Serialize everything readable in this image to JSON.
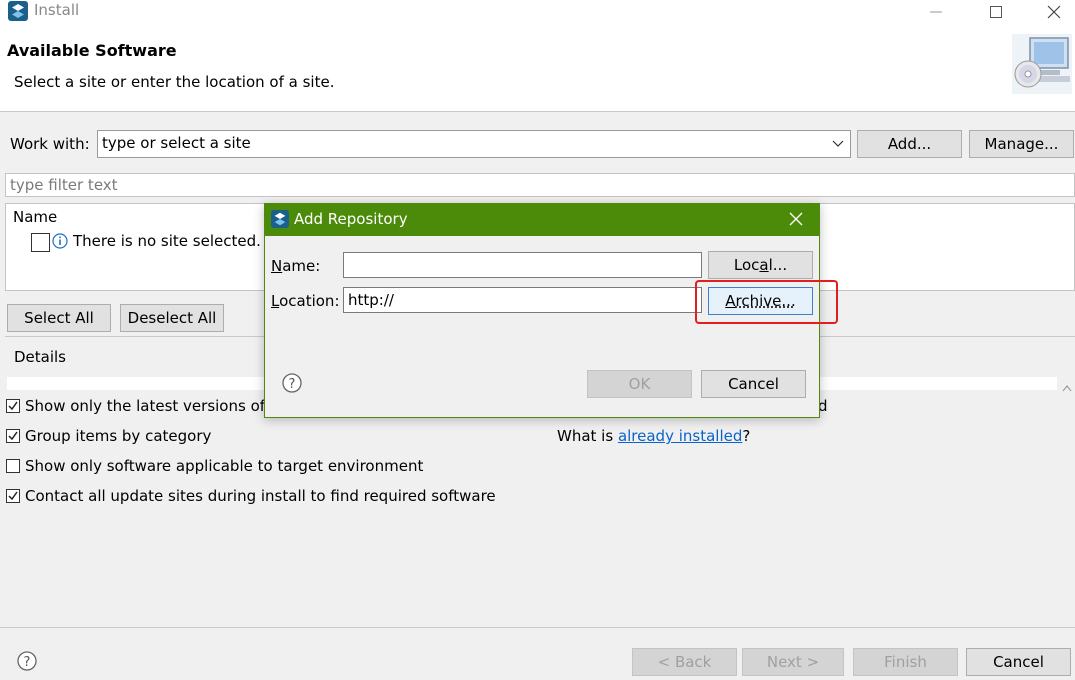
{
  "window": {
    "title": "Install",
    "controls": [
      "minimize-icon",
      "maximize-icon",
      "close-icon"
    ]
  },
  "header": {
    "title": "Available Software",
    "subtitle": "Select a site or enter the location of a site."
  },
  "work_with": {
    "label": "Work with:",
    "value": "type or select a site",
    "add_label": "Add...",
    "manage_label": "Manage..."
  },
  "filter": {
    "placeholder": "type filter text"
  },
  "tree": {
    "column_header": "Name",
    "message": "There is no site selected."
  },
  "selection": {
    "select_all": "Select All",
    "deselect_all": "Deselect All"
  },
  "details": {
    "label": "Details"
  },
  "options": {
    "latest_versions": {
      "label": "Show only the latest versions of a",
      "checked": true
    },
    "group_by_category": {
      "label": "Group items by category",
      "checked": true
    },
    "applicable_only": {
      "label": "Show only software applicable to target environment",
      "checked": false
    },
    "contact_all": {
      "label": "Contact all update sites during install to find required software",
      "checked": true
    },
    "hidden_suffix": "d",
    "what_is": "What is ",
    "already_installed": "already installed",
    "question_mark": "?"
  },
  "footer": {
    "back": "< Back",
    "next": "Next >",
    "finish": "Finish",
    "cancel": "Cancel"
  },
  "dialog": {
    "title": "Add Repository",
    "name_label_first": "N",
    "name_label_rest": "ame:",
    "name_value": "",
    "location_label_first": "L",
    "location_label_rest": "ocation:",
    "location_value": "http://",
    "local_label_first": "L",
    "local_label_pre": "Loc",
    "local_label_u": "a",
    "local_label_post": "l...",
    "archive_label_u": "A",
    "archive_label_rest": "rchive...",
    "ok": "OK",
    "cancel": "Cancel"
  },
  "colors": {
    "dialog_title_bar": "#4c8a0a",
    "link": "#0b63c9",
    "highlight": "#e02020"
  }
}
